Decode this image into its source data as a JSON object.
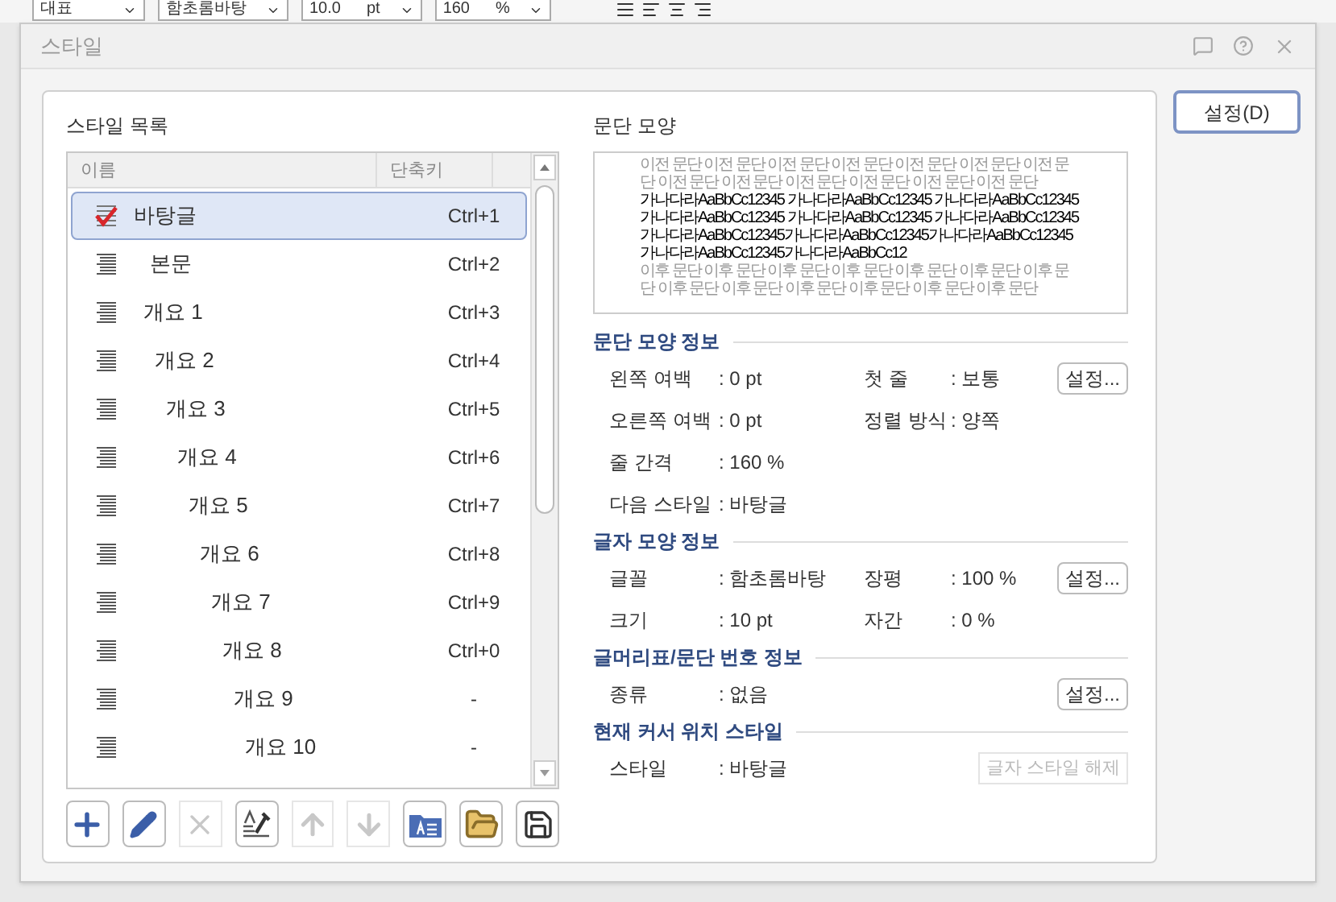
{
  "toolbar": {
    "fields": [
      {
        "value": "대표"
      },
      {
        "value": "함초롬바탕"
      },
      {
        "value": "10.0",
        "unit": "pt"
      },
      {
        "value": "160",
        "unit": "%"
      }
    ]
  },
  "dialog": {
    "title": "스타일"
  },
  "style_list": {
    "label": "스타일 목록",
    "columns": [
      "이름",
      "단축키"
    ],
    "rows": [
      {
        "name": "바탕글",
        "shortcut": "Ctrl+1",
        "selected": true,
        "kind": "current"
      },
      {
        "name": "본문",
        "shortcut": "Ctrl+2",
        "selected": false,
        "kind": "paragraph"
      },
      {
        "name": "개요 1",
        "shortcut": "Ctrl+3",
        "selected": false,
        "kind": "paragraph"
      },
      {
        "name": "개요 2",
        "shortcut": "Ctrl+4",
        "selected": false,
        "kind": "paragraph"
      },
      {
        "name": "개요 3",
        "shortcut": "Ctrl+5",
        "selected": false,
        "kind": "paragraph"
      },
      {
        "name": "개요 4",
        "shortcut": "Ctrl+6",
        "selected": false,
        "kind": "paragraph"
      },
      {
        "name": "개요 5",
        "shortcut": "Ctrl+7",
        "selected": false,
        "kind": "paragraph"
      },
      {
        "name": "개요 6",
        "shortcut": "Ctrl+8",
        "selected": false,
        "kind": "paragraph"
      },
      {
        "name": "개요 7",
        "shortcut": "Ctrl+9",
        "selected": false,
        "kind": "paragraph"
      },
      {
        "name": "개요 8",
        "shortcut": "Ctrl+0",
        "selected": false,
        "kind": "paragraph"
      },
      {
        "name": "개요 9",
        "shortcut": "-",
        "selected": false,
        "kind": "paragraph"
      },
      {
        "name": "개요 10",
        "shortcut": "-",
        "selected": false,
        "kind": "paragraph"
      }
    ]
  },
  "list_buttons": [
    {
      "kind": "add",
      "disabled": false
    },
    {
      "kind": "edit",
      "disabled": false
    },
    {
      "kind": "delete",
      "disabled": true
    },
    {
      "kind": "replace",
      "disabled": false
    },
    {
      "kind": "up",
      "disabled": true
    },
    {
      "kind": "down",
      "disabled": true
    },
    {
      "kind": "import",
      "disabled": false
    },
    {
      "kind": "open",
      "disabled": false
    },
    {
      "kind": "save",
      "disabled": false
    }
  ],
  "preview": {
    "label": "문단 모양",
    "paragraphs": [
      {
        "kind": "before",
        "text": "이전 문단 이전 문단 이전 문단 이전 문단 이전 문단 이전 문단 이전 문단 이전 문단 이전 문단 이전 문단 이전 문단 이전 문단 이전 문단"
      },
      {
        "kind": "current",
        "text": "가나다라AaBbCc12345 가나다라AaBbCc12345 가나다라AaBbCc12345 가나다라AaBbCc12345 가나다라AaBbCc12345 가나다라AaBbCc12345가나다라AaBbCc12345가나다라AaBbCc12345가나다라AaBbCc12345가나다라AaBbCc12345가나다라AaBbCc12"
      },
      {
        "kind": "after",
        "text": "이후 문단 이후 문단 이후 문단 이후 문단 이후 문단 이후 문단 이후 문단 이후 문단 이후 문단 이후 문단 이후 문단 이후 문단 이후 문단"
      }
    ]
  },
  "sections": [
    {
      "title": "문단 모양 정보",
      "rows": [
        {
          "fields": [
            {
              "label": "왼쪽 여백",
              "value": ": 0 pt"
            },
            {
              "label": "첫 줄",
              "value": ": 보통"
            }
          ],
          "button": {
            "label": "설정...",
            "disabled": false
          }
        },
        {
          "fields": [
            {
              "label": "오른쪽 여백",
              "value": ": 0 pt"
            },
            {
              "label": "정렬 방식",
              "value": ": 양쪽"
            }
          ]
        },
        {
          "fields": [
            {
              "label": "줄 간격",
              "value": ": 160 %"
            }
          ]
        },
        {
          "fields": [
            {
              "label": "다음 스타일",
              "value": ": 바탕글"
            }
          ]
        }
      ]
    },
    {
      "title": "글자 모양 정보",
      "rows": [
        {
          "fields": [
            {
              "label": "글꼴",
              "value": ": 함초롬바탕"
            },
            {
              "label": "장평",
              "value": ": 100 %"
            }
          ],
          "button": {
            "label": "설정...",
            "disabled": false
          }
        },
        {
          "fields": [
            {
              "label": "크기",
              "value": ": 10 pt"
            },
            {
              "label": "자간",
              "value": ": 0 %"
            }
          ]
        }
      ]
    },
    {
      "title": "글머리표/문단 번호 정보",
      "rows": [
        {
          "fields": [
            {
              "label": "종류",
              "value": ": 없음"
            }
          ],
          "button": {
            "label": "설정...",
            "disabled": false
          }
        }
      ]
    },
    {
      "title": "현재 커서 위치 스타일",
      "rows": [
        {
          "fields": [
            {
              "label": "스타일",
              "value": ": 바탕글"
            }
          ],
          "button": {
            "label": "글자 스타일 해제",
            "disabled": true
          }
        }
      ]
    }
  ],
  "side_button": {
    "label": "설정(D)"
  }
}
